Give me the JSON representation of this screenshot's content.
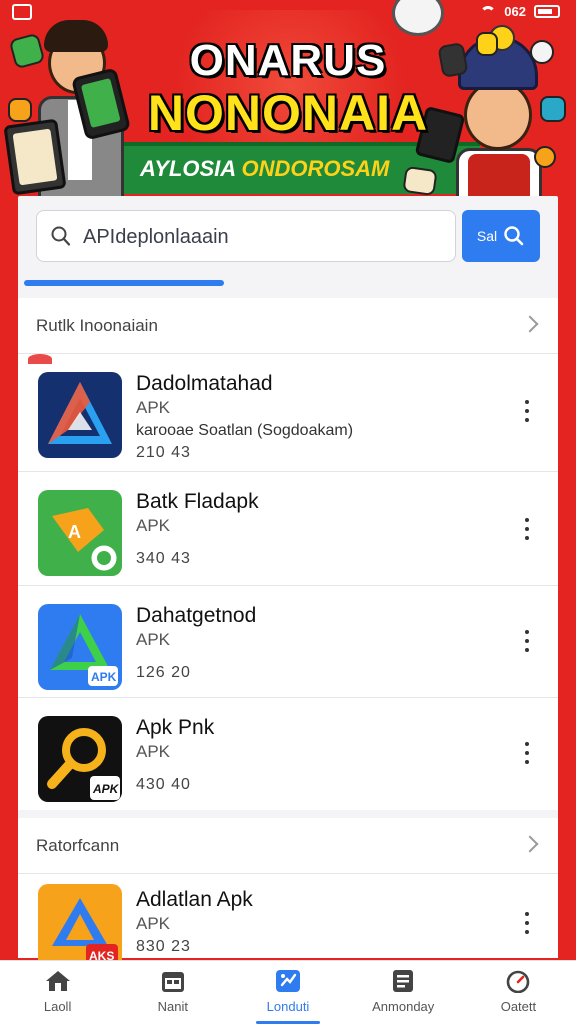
{
  "colors": {
    "background_red": "#e32420",
    "accent_blue": "#2f7cf0",
    "banner_yellow": "#ffe21a",
    "banner_green": "#1e8a3a"
  },
  "status_bar": {
    "battery_text": "062"
  },
  "banner": {
    "title_line1": "ONARUS",
    "title_line2": "NONONAIA",
    "subtitle_part1": "AYLOSIA",
    "subtitle_part2": "ONDOROSAM"
  },
  "search": {
    "value": "APIdeplonlaaain",
    "button_label": "Sal",
    "button_icon": "search-icon"
  },
  "sections": [
    {
      "title": "Rutlk Inoonaiain",
      "apps": [
        {
          "name": "Dadolmatahad",
          "type": "APK",
          "description": "karooae Soatlan (Sogdoakam)",
          "meta": "210  43",
          "icon": "blue-triangle-app-icon"
        },
        {
          "name": "Batk Fladapk",
          "type": "APK",
          "description": "",
          "meta": "340  43",
          "icon": "green-orange-app-icon"
        },
        {
          "name": "Dahatgetnod",
          "type": "APK",
          "description": "",
          "meta": "126  20",
          "icon": "blue-green-triangle-app-icon",
          "badge": "APK"
        },
        {
          "name": "Apk Pnk",
          "type": "APK",
          "description": "",
          "meta": "430  40",
          "icon": "magnifier-app-icon",
          "badge": "APK"
        }
      ]
    },
    {
      "title": "Ratorfcann",
      "apps": [
        {
          "name": "Adlatlan Apk",
          "type": "APK",
          "description": "",
          "meta": "830  23",
          "icon": "orange-blue-app-icon",
          "badge": "AKS"
        }
      ]
    }
  ],
  "bottom_nav": [
    {
      "label": "Laoll",
      "icon": "home-icon",
      "active": false
    },
    {
      "label": "Nanit",
      "icon": "calendar-icon",
      "active": false
    },
    {
      "label": "Londuti",
      "icon": "apps-icon",
      "active": true
    },
    {
      "label": "Anmonday",
      "icon": "document-icon",
      "active": false
    },
    {
      "label": "Oatett",
      "icon": "gauge-icon",
      "active": false
    }
  ]
}
